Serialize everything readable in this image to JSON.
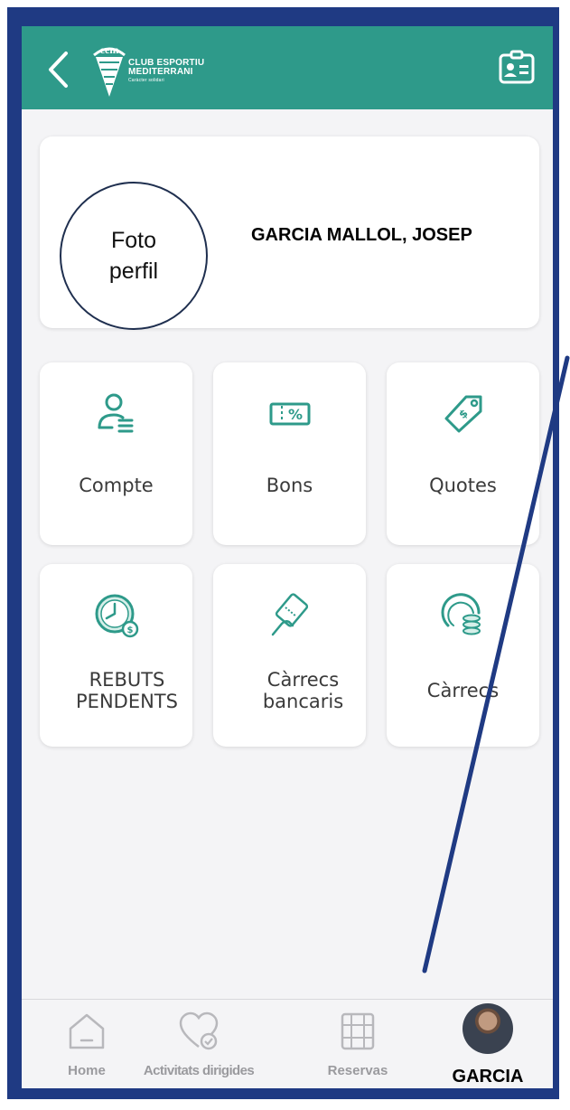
{
  "header": {
    "logo_line1": "CLUB ESPORTIU",
    "logo_line2": "MEDITERRANI",
    "logo_tagline": "Caràcter solidari",
    "logo_mark": "cem"
  },
  "profile": {
    "photo_placeholder": "Foto perfil",
    "name": "GARCIA MALLOL, JOSEP"
  },
  "tiles": [
    {
      "label": "Compte",
      "icon": "user-list-icon"
    },
    {
      "label": "Bons",
      "icon": "voucher-percent-icon"
    },
    {
      "label": "Quotes",
      "icon": "price-tag-icon"
    },
    {
      "label": "REBUTS PENDENTS",
      "icon": "clock-money-icon"
    },
    {
      "label": "Càrrecs bancaris",
      "icon": "card-hand-icon"
    },
    {
      "label": "Càrrecs",
      "icon": "coins-icon"
    }
  ],
  "bottom_nav": {
    "items": [
      {
        "label": "Home",
        "icon": "home-icon"
      },
      {
        "label": "Activitats dirigides",
        "icon": "heart-check-icon"
      },
      {
        "label": "Reservas",
        "icon": "calendar-grid-icon"
      },
      {
        "label": "GARCIA",
        "icon": "avatar"
      }
    ]
  },
  "colors": {
    "brand_teal": "#2e9a8a",
    "frame_blue": "#1f3a83"
  }
}
